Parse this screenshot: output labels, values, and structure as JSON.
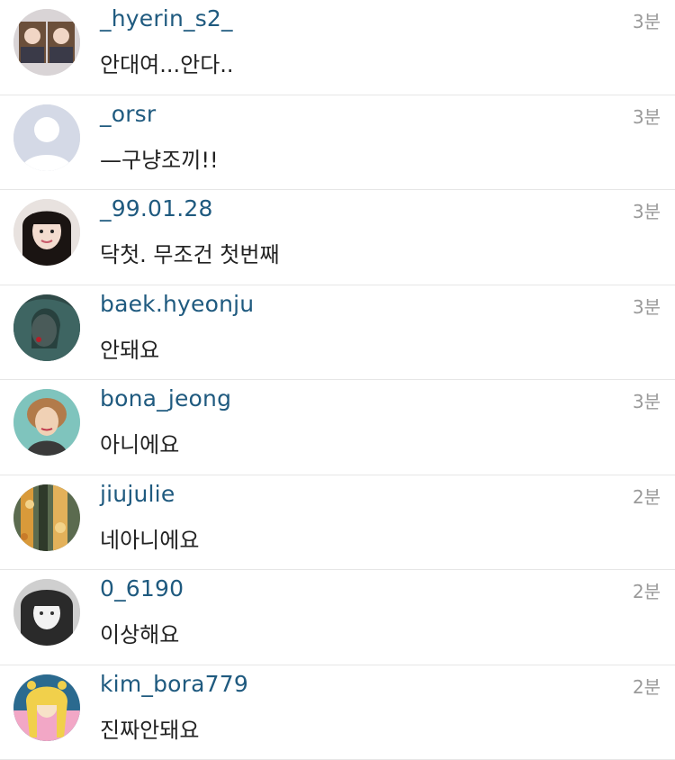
{
  "comments": [
    {
      "username": "_hyerin_s2_",
      "text": "안대여...안다..",
      "time": "3분",
      "avatar_icon": "photo-avatar-icon"
    },
    {
      "username": "_orsr",
      "text": "—구냥조끼!!",
      "time": "3분",
      "avatar_icon": "default-avatar-icon"
    },
    {
      "username": "_99.01.28",
      "text": "닥첫. 무조건 첫번째",
      "time": "3분",
      "avatar_icon": "photo-avatar-icon"
    },
    {
      "username": "baek.hyeonju",
      "text": "안돼요",
      "time": "3분",
      "avatar_icon": "photo-avatar-icon"
    },
    {
      "username": "bona_jeong",
      "text": "아니에요",
      "time": "3분",
      "avatar_icon": "photo-avatar-icon"
    },
    {
      "username": "jiujulie",
      "text": "네아니에요",
      "time": "2분",
      "avatar_icon": "photo-avatar-icon"
    },
    {
      "username": "0_6190",
      "text": "이상해요",
      "time": "2분",
      "avatar_icon": "photo-avatar-icon"
    },
    {
      "username": "kim_bora779",
      "text": "진짜안돼요",
      "time": "2분",
      "avatar_icon": "photo-avatar-icon"
    }
  ],
  "colors": {
    "username": "#1f5a7f",
    "text": "#222222",
    "time": "#9a9a9a",
    "divider": "#e6e6e6"
  }
}
